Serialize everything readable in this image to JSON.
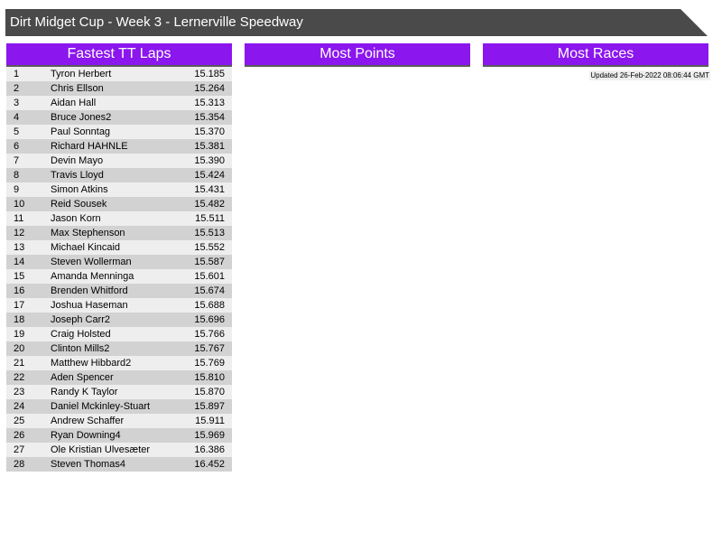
{
  "header": {
    "title": "Dirt Midget Cup - Week 3 - Lernerville Speedway"
  },
  "panels": {
    "fastest_laps_title": "Fastest TT Laps",
    "most_points_title": "Most Points",
    "most_races_title": "Most Races"
  },
  "updated_text": "Updated 26-Feb-2022 08:06:44 GMT",
  "fastest_laps": [
    {
      "pos": "1",
      "name": "Tyron Herbert",
      "time": "15.185"
    },
    {
      "pos": "2",
      "name": "Chris Ellson",
      "time": "15.264"
    },
    {
      "pos": "3",
      "name": "Aidan Hall",
      "time": "15.313"
    },
    {
      "pos": "4",
      "name": "Bruce Jones2",
      "time": "15.354"
    },
    {
      "pos": "5",
      "name": "Paul Sonntag",
      "time": "15.370"
    },
    {
      "pos": "6",
      "name": "Richard HAHNLE",
      "time": "15.381"
    },
    {
      "pos": "7",
      "name": "Devin Mayo",
      "time": "15.390"
    },
    {
      "pos": "8",
      "name": "Travis Lloyd",
      "time": "15.424"
    },
    {
      "pos": "9",
      "name": "Simon Atkins",
      "time": "15.431"
    },
    {
      "pos": "10",
      "name": "Reid Sousek",
      "time": "15.482"
    },
    {
      "pos": "11",
      "name": "Jason Korn",
      "time": "15.511"
    },
    {
      "pos": "12",
      "name": "Max Stephenson",
      "time": "15.513"
    },
    {
      "pos": "13",
      "name": "Michael Kincaid",
      "time": "15.552"
    },
    {
      "pos": "14",
      "name": "Steven Wollerman",
      "time": "15.587"
    },
    {
      "pos": "15",
      "name": "Amanda Menninga",
      "time": "15.601"
    },
    {
      "pos": "16",
      "name": "Brenden Whitford",
      "time": "15.674"
    },
    {
      "pos": "17",
      "name": "Joshua Haseman",
      "time": "15.688"
    },
    {
      "pos": "18",
      "name": "Joseph Carr2",
      "time": "15.696"
    },
    {
      "pos": "19",
      "name": "Craig Holsted",
      "time": "15.766"
    },
    {
      "pos": "20",
      "name": "Clinton Mills2",
      "time": "15.767"
    },
    {
      "pos": "21",
      "name": "Matthew Hibbard2",
      "time": "15.769"
    },
    {
      "pos": "22",
      "name": "Aden Spencer",
      "time": "15.810"
    },
    {
      "pos": "23",
      "name": "Randy K Taylor",
      "time": "15.870"
    },
    {
      "pos": "24",
      "name": "Daniel Mckinley-Stuart",
      "time": "15.897"
    },
    {
      "pos": "25",
      "name": "Andrew Schaffer",
      "time": "15.911"
    },
    {
      "pos": "26",
      "name": "Ryan Downing4",
      "time": "15.969"
    },
    {
      "pos": "27",
      "name": "Ole Kristian Ulvesæter",
      "time": "16.386"
    },
    {
      "pos": "28",
      "name": "Steven Thomas4",
      "time": "16.452"
    }
  ],
  "colors": {
    "title_bar": "#4a4a4a",
    "panel_header": "#8b16ee",
    "row_light": "#eeeeee",
    "row_dark": "#d2d2d2"
  }
}
